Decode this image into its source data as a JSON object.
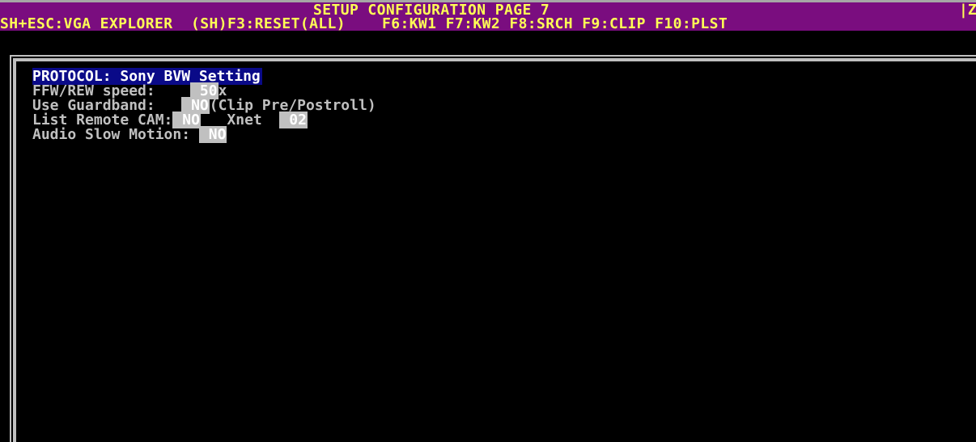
{
  "header": {
    "title": "SETUP CONFIGURATION PAGE 7",
    "right_marker": "|Z:",
    "hotkeys": [
      "SH+ESC:VGA EXPLORER",
      "(SH)F3:RESET(ALL)",
      "F6:KW1",
      "F7:KW2",
      "F8:SRCH",
      "F9:CLIP",
      "F10:PLST"
    ]
  },
  "settings": {
    "protocol_label": "PROTOCOL: Sony BVW Setting",
    "ffw_label": "FFW/REW speed:",
    "ffw_value": "50",
    "ffw_unit": "x",
    "guardband_label": "Use Guardband:",
    "guardband_value": "NO",
    "guardband_note": "(Clip Pre/Postroll)",
    "remote_cam_label": "List Remote CAM:",
    "remote_cam_value": "NO",
    "xnet_label": "Xnet",
    "xnet_value": "02",
    "audio_slow_label": "Audio Slow Motion:",
    "audio_slow_value": "NO"
  },
  "colors": {
    "titlebar": "#7a0d7f",
    "title_text": "#ffff55",
    "highlight": "#0a0a88",
    "value_bg": "#c0c0c0"
  }
}
